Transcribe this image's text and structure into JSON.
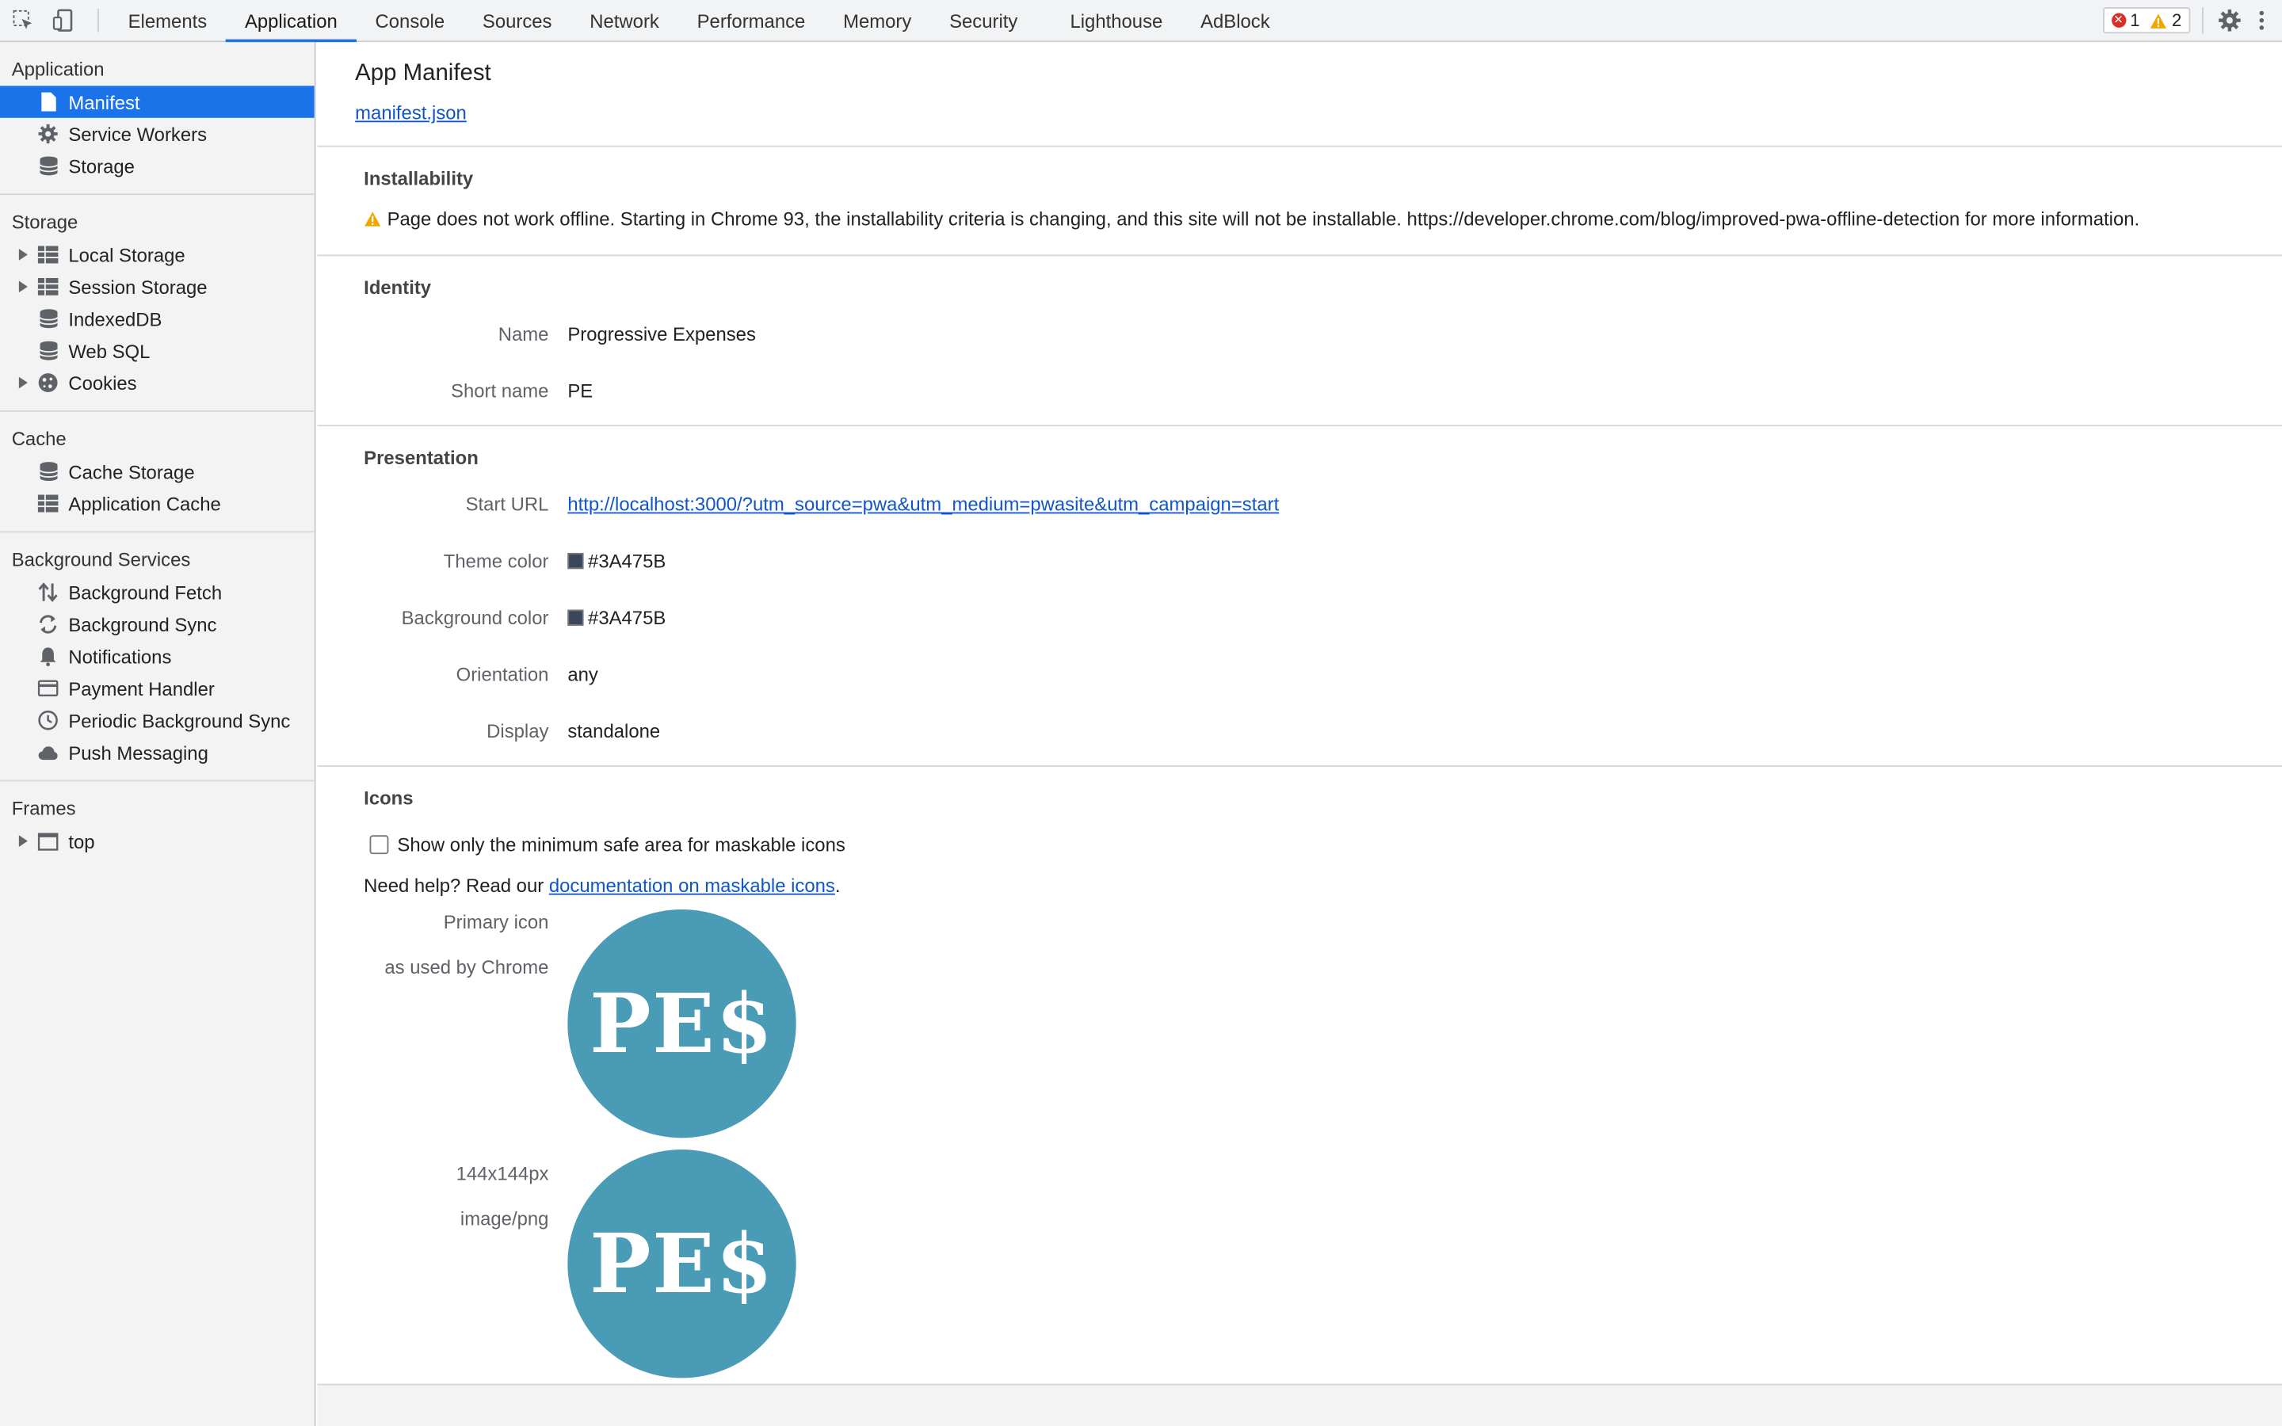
{
  "toolbar": {
    "tabs": [
      "Elements",
      "Application",
      "Console",
      "Sources",
      "Network",
      "Performance",
      "Memory",
      "Security",
      "Lighthouse",
      "AdBlock"
    ],
    "active_tab": "Application",
    "error_count": "1",
    "warning_count": "2",
    "icons": [
      "inspect-icon",
      "device-toggle-icon",
      "settings-gear-icon",
      "more-options-icon"
    ]
  },
  "sidebar": {
    "groups": [
      {
        "title": "Application",
        "items": [
          {
            "label": "Manifest",
            "icon": "document-icon",
            "selected": true
          },
          {
            "label": "Service Workers",
            "icon": "gear-icon"
          },
          {
            "label": "Storage",
            "icon": "database-icon"
          }
        ]
      },
      {
        "title": "Storage",
        "items": [
          {
            "label": "Local Storage",
            "icon": "grid-icon",
            "expandable": true
          },
          {
            "label": "Session Storage",
            "icon": "grid-icon",
            "expandable": true
          },
          {
            "label": "IndexedDB",
            "icon": "database-icon"
          },
          {
            "label": "Web SQL",
            "icon": "database-icon"
          },
          {
            "label": "Cookies",
            "icon": "cookie-icon",
            "expandable": true
          }
        ]
      },
      {
        "title": "Cache",
        "items": [
          {
            "label": "Cache Storage",
            "icon": "database-icon"
          },
          {
            "label": "Application Cache",
            "icon": "grid-icon"
          }
        ]
      },
      {
        "title": "Background Services",
        "items": [
          {
            "label": "Background Fetch",
            "icon": "up-down-arrows-icon"
          },
          {
            "label": "Background Sync",
            "icon": "sync-icon"
          },
          {
            "label": "Notifications",
            "icon": "bell-icon"
          },
          {
            "label": "Payment Handler",
            "icon": "card-icon"
          },
          {
            "label": "Periodic Background Sync",
            "icon": "clock-icon"
          },
          {
            "label": "Push Messaging",
            "icon": "cloud-icon"
          }
        ]
      },
      {
        "title": "Frames",
        "items": [
          {
            "label": "top",
            "icon": "frame-icon",
            "expandable": true
          }
        ]
      }
    ]
  },
  "manifest": {
    "title": "App Manifest",
    "link": "manifest.json",
    "installability": {
      "title": "Installability",
      "warning": "Page does not work offline. Starting in Chrome 93, the installability criteria is changing, and this site will not be installable. https://developer.chrome.com/blog/improved-pwa-offline-detection for more information."
    },
    "identity": {
      "title": "Identity",
      "name_label": "Name",
      "name": "Progressive Expenses",
      "short_name_label": "Short name",
      "short_name": "PE"
    },
    "presentation": {
      "title": "Presentation",
      "start_url_label": "Start URL",
      "start_url": "http://localhost:3000/?utm_source=pwa&utm_medium=pwasite&utm_campaign=start",
      "theme_color_label": "Theme color",
      "theme_color": "#3A475B",
      "background_color_label": "Background color",
      "background_color": "#3A475B",
      "orientation_label": "Orientation",
      "orientation": "any",
      "display_label": "Display",
      "display": "standalone"
    },
    "icons": {
      "title": "Icons",
      "checkbox_label": "Show only the minimum safe area for maskable icons",
      "help_prefix": "Need help? Read our ",
      "help_link": "documentation on maskable icons",
      "help_suffix": ".",
      "primary_label": "Primary icon",
      "primary_sub": "as used by Chrome",
      "size_label": "144x144px",
      "type_label": "image/png",
      "icon_text": "PE$",
      "icon_color": "#4A9BB6"
    }
  }
}
